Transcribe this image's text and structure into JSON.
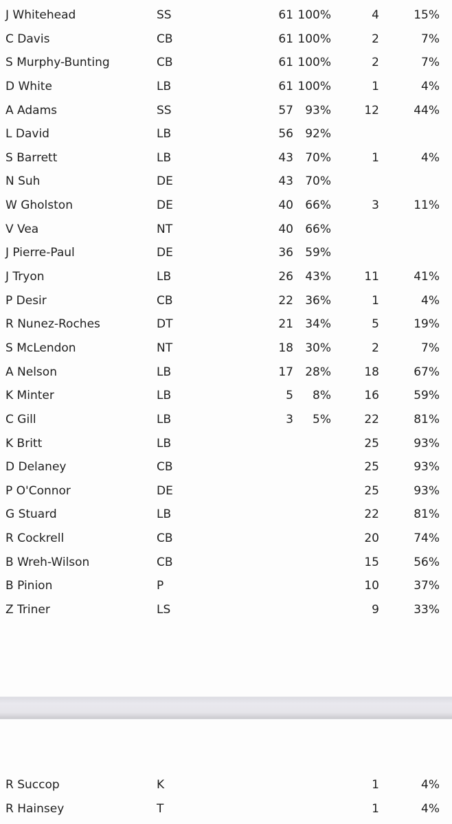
{
  "section1": [
    {
      "name": "J Whitehead",
      "pos": "SS",
      "snaps": "61",
      "snaps_pct": "100%",
      "st": "4",
      "st_pct": "15%"
    },
    {
      "name": "C Davis",
      "pos": "CB",
      "snaps": "61",
      "snaps_pct": "100%",
      "st": "2",
      "st_pct": "7%"
    },
    {
      "name": "S Murphy-Bunting",
      "pos": "CB",
      "snaps": "61",
      "snaps_pct": "100%",
      "st": "2",
      "st_pct": "7%"
    },
    {
      "name": "D White",
      "pos": "LB",
      "snaps": "61",
      "snaps_pct": "100%",
      "st": "1",
      "st_pct": "4%"
    },
    {
      "name": "A Adams",
      "pos": "SS",
      "snaps": "57",
      "snaps_pct": "93%",
      "st": "12",
      "st_pct": "44%"
    },
    {
      "name": "L David",
      "pos": "LB",
      "snaps": "56",
      "snaps_pct": "92%",
      "st": "",
      "st_pct": ""
    },
    {
      "name": "S Barrett",
      "pos": "LB",
      "snaps": "43",
      "snaps_pct": "70%",
      "st": "1",
      "st_pct": "4%"
    },
    {
      "name": "N Suh",
      "pos": "DE",
      "snaps": "43",
      "snaps_pct": "70%",
      "st": "",
      "st_pct": ""
    },
    {
      "name": "W Gholston",
      "pos": "DE",
      "snaps": "40",
      "snaps_pct": "66%",
      "st": "3",
      "st_pct": "11%"
    },
    {
      "name": "V Vea",
      "pos": "NT",
      "snaps": "40",
      "snaps_pct": "66%",
      "st": "",
      "st_pct": ""
    },
    {
      "name": "J Pierre-Paul",
      "pos": "DE",
      "snaps": "36",
      "snaps_pct": "59%",
      "st": "",
      "st_pct": ""
    },
    {
      "name": "J Tryon",
      "pos": "LB",
      "snaps": "26",
      "snaps_pct": "43%",
      "st": "11",
      "st_pct": "41%"
    },
    {
      "name": "P Desir",
      "pos": "CB",
      "snaps": "22",
      "snaps_pct": "36%",
      "st": "1",
      "st_pct": "4%"
    },
    {
      "name": "R Nunez-Roches",
      "pos": "DT",
      "snaps": "21",
      "snaps_pct": "34%",
      "st": "5",
      "st_pct": "19%"
    },
    {
      "name": "S McLendon",
      "pos": "NT",
      "snaps": "18",
      "snaps_pct": "30%",
      "st": "2",
      "st_pct": "7%"
    },
    {
      "name": "A Nelson",
      "pos": "LB",
      "snaps": "17",
      "snaps_pct": "28%",
      "st": "18",
      "st_pct": "67%"
    },
    {
      "name": "K Minter",
      "pos": "LB",
      "snaps": "5",
      "snaps_pct": "8%",
      "st": "16",
      "st_pct": "59%"
    },
    {
      "name": "C Gill",
      "pos": "LB",
      "snaps": "3",
      "snaps_pct": "5%",
      "st": "22",
      "st_pct": "81%"
    },
    {
      "name": "K Britt",
      "pos": "LB",
      "snaps": "",
      "snaps_pct": "",
      "st": "25",
      "st_pct": "93%"
    },
    {
      "name": "D Delaney",
      "pos": "CB",
      "snaps": "",
      "snaps_pct": "",
      "st": "25",
      "st_pct": "93%"
    },
    {
      "name": "P O'Connor",
      "pos": "DE",
      "snaps": "",
      "snaps_pct": "",
      "st": "25",
      "st_pct": "93%"
    },
    {
      "name": "G Stuard",
      "pos": "LB",
      "snaps": "",
      "snaps_pct": "",
      "st": "22",
      "st_pct": "81%"
    },
    {
      "name": "R Cockrell",
      "pos": "CB",
      "snaps": "",
      "snaps_pct": "",
      "st": "20",
      "st_pct": "74%"
    },
    {
      "name": "B Wreh-Wilson",
      "pos": "CB",
      "snaps": "",
      "snaps_pct": "",
      "st": "15",
      "st_pct": "56%"
    },
    {
      "name": "B Pinion",
      "pos": "P",
      "snaps": "",
      "snaps_pct": "",
      "st": "10",
      "st_pct": "37%"
    },
    {
      "name": "Z Triner",
      "pos": "LS",
      "snaps": "",
      "snaps_pct": "",
      "st": "9",
      "st_pct": "33%"
    }
  ],
  "section2": [
    {
      "name": "R Succop",
      "pos": "K",
      "snaps": "",
      "snaps_pct": "",
      "st": "1",
      "st_pct": "4%"
    },
    {
      "name": "R Hainsey",
      "pos": "T",
      "snaps": "",
      "snaps_pct": "",
      "st": "1",
      "st_pct": "4%"
    }
  ]
}
